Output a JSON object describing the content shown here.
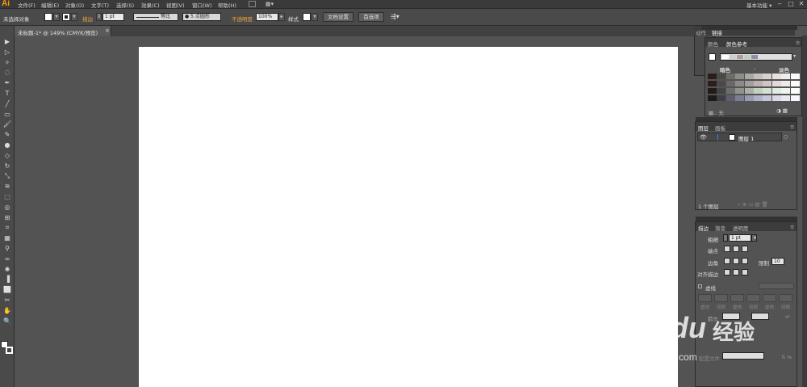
{
  "app": {
    "logo": "Ai",
    "workspace": "基本功能 ▾"
  },
  "menu": [
    "文件(F)",
    "编辑(E)",
    "对象(O)",
    "文字(T)",
    "选择(S)",
    "效果(C)",
    "视图(V)",
    "窗口(W)",
    "帮助(H)"
  ],
  "window_controls": {
    "minimize": "‒",
    "restore": "□",
    "close": "✕"
  },
  "controlbar": {
    "selection": "未选择对象",
    "stroke_label": "描边",
    "stroke_weight": "1 pt",
    "stroke_profile": "等比",
    "brush": "● 5 点圆形",
    "opacity_label": "不透明度",
    "opacity_value": "100%",
    "style_label": "样式",
    "doc_setup_button": "文档设置",
    "prefs_button": "首选项"
  },
  "document_tab": {
    "title": "未标题-1* @ 149% (CMYK/预览)",
    "close": "×"
  },
  "tools": [
    "select-icon",
    "direct-select-icon",
    "magic-wand-icon",
    "lasso-icon",
    "pen-icon",
    "type-icon",
    "line-icon",
    "rectangle-icon",
    "paintbrush-icon",
    "pencil-icon",
    "blob-brush-icon",
    "eraser-icon",
    "rotate-icon",
    "scale-icon",
    "warp-icon",
    "free-transform-icon",
    "shape-builder-icon",
    "perspective-icon",
    "mesh-icon",
    "gradient-icon",
    "eyedropper-icon",
    "blend-icon",
    "symbol-sprayer-icon",
    "column-graph-icon",
    "artboard-icon",
    "slice-icon",
    "hand-icon",
    "zoom-icon"
  ],
  "tool_glyphs": [
    "▶",
    "▷",
    "✧",
    "◌",
    "✒",
    "T",
    "╱",
    "▭",
    "🖌",
    "✎",
    "●",
    "◇",
    "↻",
    "⤡",
    "≋",
    "⬚",
    "◎",
    "⊞",
    "⌗",
    "▦",
    "⚲",
    "∞",
    "✺",
    "▐",
    "⬜",
    "✂",
    "✋",
    "🔍"
  ],
  "panels": {
    "top_collapsed_tabs": [
      "动作",
      "链接"
    ],
    "color_panel": {
      "tabs": [
        "颜色",
        "颜色参考"
      ],
      "dark_label": "暗色",
      "light_label": "淡色",
      "footer_none": "无"
    },
    "layers_panel": {
      "tabs": [
        "图层",
        "画板"
      ],
      "layer_name": "图层 1",
      "footer_count": "1 个图层"
    },
    "stroke_panel": {
      "tabs": [
        "描边",
        "渐变",
        "透明度"
      ],
      "weight_label": "粗细",
      "weight_value": "1 pt",
      "cap_label": "端点",
      "corner_label": "边角",
      "limit_label": "限制",
      "limit_value": "10",
      "align_label": "对齐描边",
      "dashed_label": "虚线",
      "dash_labels": [
        "虚线",
        "间隙",
        "虚线",
        "间隙",
        "虚线",
        "间隙"
      ],
      "arrow_label": "箭头",
      "profile_label": "配置文件"
    }
  },
  "color_guide_grid": [
    [
      "#2a1e1c",
      "#4a4a48",
      "#6d6c69",
      "#8e8d89",
      "#aaa8a4",
      "#c4c1bb",
      "#d6d2cc",
      "#e6e3de",
      "#f0eeea",
      "#fafaf8"
    ],
    [
      "#2b1f1d",
      "#4b4a4a",
      "#6a6868",
      "#8d8a8a",
      "#a59e9e",
      "#bcb2b2",
      "#cfc6c6",
      "#e2dada",
      "#eeeaea",
      "#fafafa"
    ],
    [
      "#221a18",
      "#434544",
      "#6a6e6a",
      "#8e938c",
      "#a9b3a7",
      "#c2cfc1",
      "#d3e0d3",
      "#e0ece0",
      "#edf5ec",
      "#fbfdfb"
    ],
    [
      "#1f1a1a",
      "#3e3e48",
      "#5e5f6e",
      "#7d7e94",
      "#9a9ab4",
      "#b1b1c9",
      "#c6c6db",
      "#d8d8e6",
      "#e8e8f2",
      "#f8f8fc"
    ]
  ],
  "color_guide_swatches": [
    "#ffffff",
    "#d5cdc5",
    "#a9a29c",
    "#c0ccc0",
    "#8d8ea8"
  ],
  "watermark": {
    "logo": "Bai du",
    "cn": "经验",
    "url": "jingyan.baidu.com"
  }
}
